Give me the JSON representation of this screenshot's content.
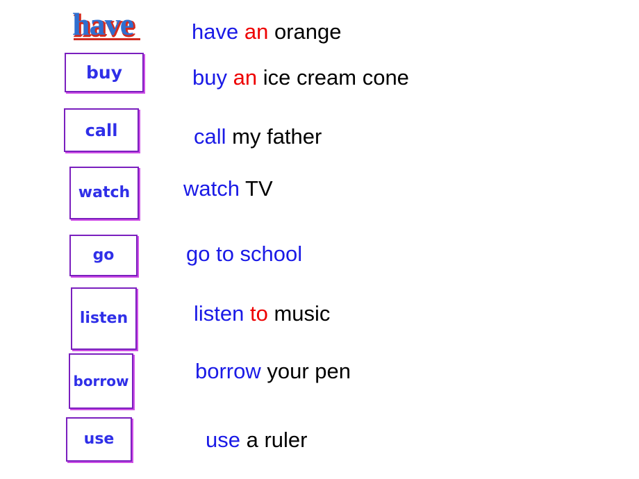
{
  "slide": {
    "title_word": "have",
    "background_color": "#ffffff",
    "colors": {
      "verb_blue": "#1a1ae6",
      "article_red": "#ee0000",
      "body_black": "#000000",
      "box_border_purple": "#7a1fbe",
      "box_shadow_magenta": "#cf4fe6",
      "box_label_blue": "#2f2fe8",
      "title_blue": "#2f6fd0",
      "title_red_shadow": "#cf2a1e"
    }
  },
  "word_boxes": [
    {
      "id": "buy",
      "label": "buy"
    },
    {
      "id": "call",
      "label": "call"
    },
    {
      "id": "watch",
      "label": "watch"
    },
    {
      "id": "go",
      "label": "go"
    },
    {
      "id": "listen",
      "label": "listen"
    },
    {
      "id": "borrow",
      "label": "borrow"
    },
    {
      "id": "use",
      "label": "use"
    }
  ],
  "phrases": [
    {
      "id": "have-an-orange",
      "verb": "have",
      "article": "an",
      "rest": "orange",
      "full": "have an orange"
    },
    {
      "id": "buy-an-ice-cream",
      "verb": "buy",
      "article": "an",
      "rest": "ice cream cone",
      "full": "buy an ice cream cone"
    },
    {
      "id": "call-my-father",
      "verb": "call",
      "article": "",
      "rest": "my father",
      "full": "call my father"
    },
    {
      "id": "watch-tv",
      "verb": "watch",
      "article": "",
      "rest": "TV",
      "full": "watch TV"
    },
    {
      "id": "go-to-school",
      "all": "go to school",
      "full": "go to school"
    },
    {
      "id": "listen-to-music",
      "verb": "listen",
      "article": "to",
      "rest": "music",
      "full": "listen to music"
    },
    {
      "id": "borrow-your-pen",
      "verb": "borrow",
      "article": "",
      "rest": "your pen",
      "full": "borrow your pen"
    },
    {
      "id": "use-a-ruler",
      "verb": "use",
      "article": "",
      "rest": "a ruler",
      "full": "use a ruler"
    }
  ]
}
